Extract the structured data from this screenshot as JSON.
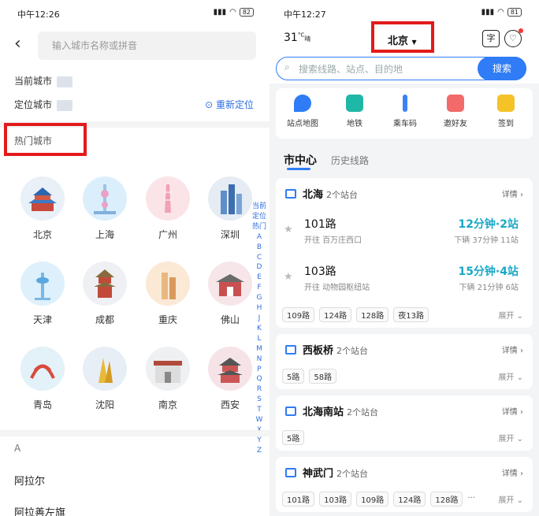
{
  "left": {
    "status": {
      "time": "中午12:26",
      "battery": "82"
    },
    "search_placeholder": "输入城市名称或拼音",
    "current_city_label": "当前城市",
    "located_city_label": "定位城市",
    "relocate_label": "重新定位",
    "hot_title": "热门城市",
    "hot_cities": [
      "北京",
      "上海",
      "广州",
      "深圳",
      "天津",
      "成都",
      "重庆",
      "佛山",
      "青岛",
      "沈阳",
      "南京",
      "西安"
    ],
    "alpha_index": [
      "当前",
      "定位",
      "热门",
      "A",
      "B",
      "C",
      "D",
      "E",
      "F",
      "G",
      "H",
      "J",
      "K",
      "L",
      "M",
      "N",
      "P",
      "Q",
      "R",
      "S",
      "T",
      "W",
      "X",
      "Y",
      "Z"
    ],
    "section_a": "A",
    "city_list": [
      "阿拉尔",
      "阿拉善左旗"
    ]
  },
  "right": {
    "status": {
      "time": "中午12:27",
      "battery": "81"
    },
    "weather": {
      "temp": "31",
      "unit": "°C",
      "cond": "晴"
    },
    "city": "北京",
    "search_placeholder": "搜索线路、站点、目的地",
    "search_button": "搜索",
    "quick_items": [
      "站点地图",
      "地铁",
      "乘车码",
      "邀好友",
      "签到"
    ],
    "tab_active": "市中心",
    "tab_other": "历史线路",
    "detail_label": "详情",
    "expand_label": "展开",
    "cards": [
      {
        "name": "北海",
        "count": "2个站台",
        "routes": [
          {
            "name": "101路",
            "dir": "开往 百万庄西口",
            "eta": "12分钟·2站",
            "next": "下辆 37分钟 11站"
          },
          {
            "name": "103路",
            "dir": "开往 动物园枢纽站",
            "eta": "15分钟·4站",
            "next": "下辆 21分钟 6站"
          }
        ],
        "tags": [
          "109路",
          "124路",
          "128路",
          "夜13路"
        ]
      },
      {
        "name": "西板桥",
        "count": "2个站台",
        "tags": [
          "5路",
          "58路"
        ]
      },
      {
        "name": "北海南站",
        "count": "2个站台",
        "tags": [
          "5路"
        ]
      },
      {
        "name": "神武门",
        "count": "2个站台",
        "tags": [
          "101路",
          "103路",
          "109路",
          "124路",
          "128路",
          "..."
        ]
      }
    ]
  }
}
